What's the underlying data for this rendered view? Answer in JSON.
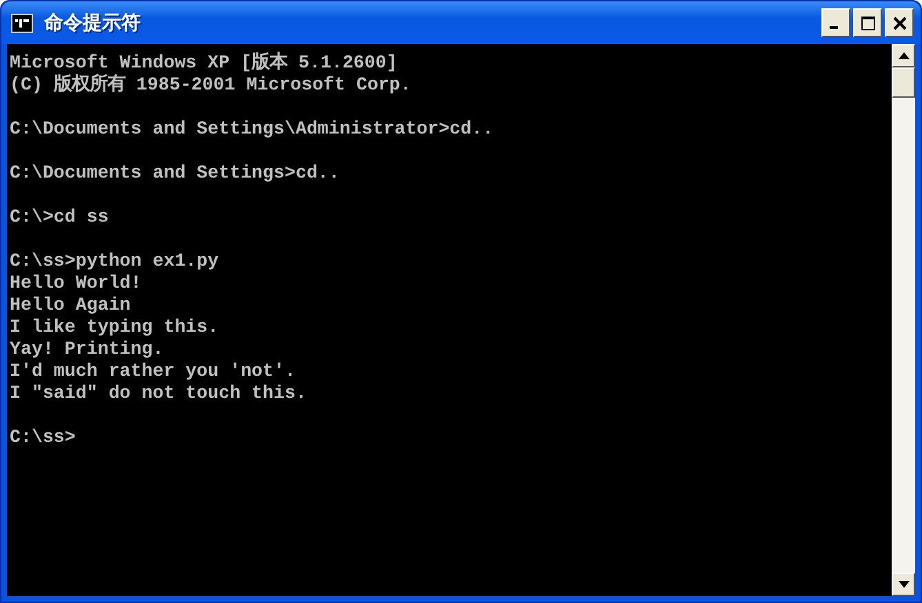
{
  "window": {
    "title": "命令提示符"
  },
  "console": {
    "blocks": [
      [
        "Microsoft Windows XP [版本 5.1.2600]",
        "(C) 版权所有 1985-2001 Microsoft Corp."
      ],
      [
        "C:\\Documents and Settings\\Administrator>cd.."
      ],
      [
        "C:\\Documents and Settings>cd.."
      ],
      [
        "C:\\>cd ss"
      ],
      [
        "C:\\ss>python ex1.py",
        "Hello World!",
        "Hello Again",
        "I like typing this.",
        "Yay! Printing.",
        "I'd much rather you 'not'.",
        "I \"said\" do not touch this."
      ],
      [
        "C:\\ss>"
      ]
    ]
  }
}
